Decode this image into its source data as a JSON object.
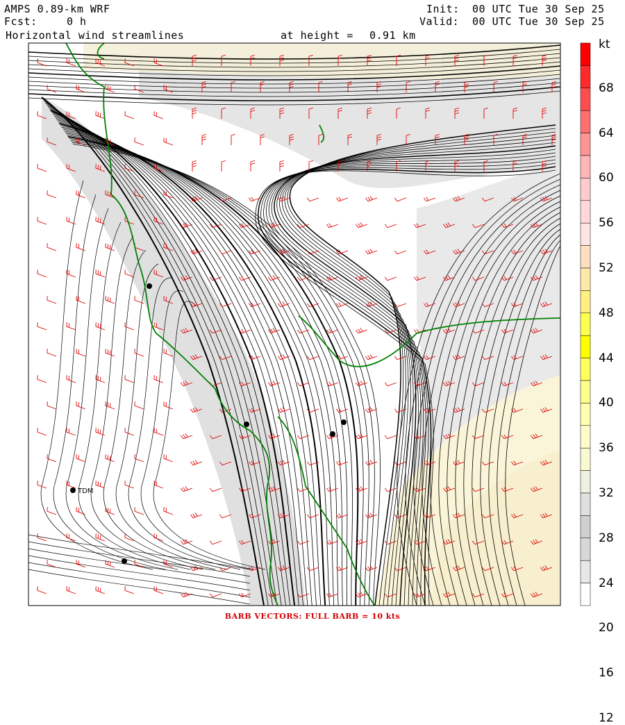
{
  "header": {
    "model": "AMPS 0.89-km WRF",
    "forecast_label": "Fcst:",
    "forecast_value": "0 h",
    "field": "Horizontal wind streamlines",
    "height_label": "at height =",
    "height_value": "0.91 km",
    "init_label": "Init:",
    "init_value": "00 UTC Tue 30 Sep 25",
    "valid_label": "Valid:",
    "valid_value": "00 UTC Tue 30 Sep 25"
  },
  "colorbar": {
    "unit": "kt",
    "ticks": [
      "68",
      "64",
      "60",
      "56",
      "52",
      "48",
      "44",
      "40",
      "36",
      "32",
      "28",
      "24",
      "20",
      "16",
      "12"
    ],
    "colors": [
      "#ff0000",
      "#ff2a2a",
      "#ff4d4d",
      "#ff7070",
      "#ff9494",
      "#ffb6b6",
      "#ffcccc",
      "#ffd9d9",
      "#ffe4e4",
      "#ffdfc0",
      "#ffe9a8",
      "#fff080",
      "#ffff4d",
      "#ffff00",
      "#ffff5c",
      "#ffff8c",
      "#ffffb0",
      "#fffccc",
      "#fafad2",
      "#f0f0e0",
      "#e0e0e0",
      "#d0d0d0",
      "#d8d8d8",
      "#e8e8e8",
      "#ffffff"
    ]
  },
  "station_label": "TDM",
  "footer": "BARB VECTORS:  FULL BARB = 10 kts",
  "colors": {
    "coast": "#008000",
    "barb": "#e00000",
    "frame": "#000000"
  }
}
